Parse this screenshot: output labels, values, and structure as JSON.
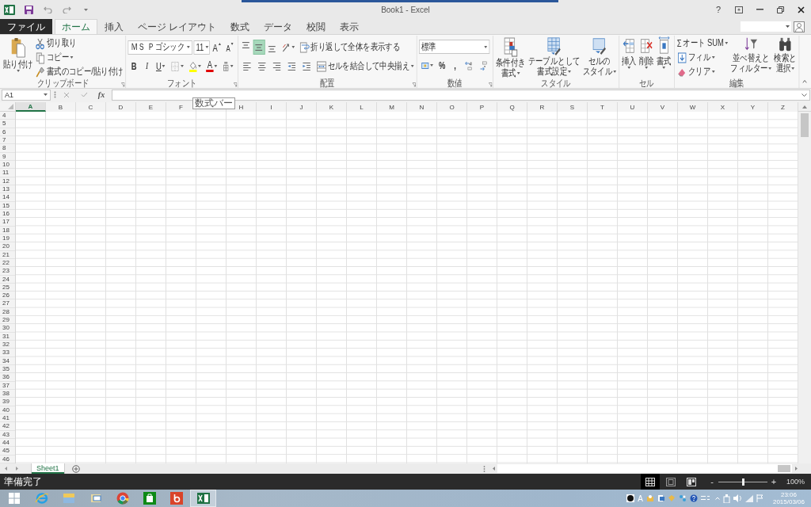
{
  "window": {
    "title": "Book1 - Excel",
    "help": "?"
  },
  "tabs": [
    {
      "label": "ファイル",
      "kind": "file",
      "selected": false
    },
    {
      "label": "ホーム",
      "kind": "tab",
      "selected": true
    },
    {
      "label": "挿入",
      "kind": "tab",
      "selected": false
    },
    {
      "label": "ページ レイアウト",
      "kind": "tab",
      "selected": false
    },
    {
      "label": "数式",
      "kind": "tab",
      "selected": false
    },
    {
      "label": "データ",
      "kind": "tab",
      "selected": false
    },
    {
      "label": "校閲",
      "kind": "tab",
      "selected": false
    },
    {
      "label": "表示",
      "kind": "tab",
      "selected": false
    }
  ],
  "ribbon": {
    "groups": [
      {
        "label": "クリップボード",
        "launcher": true,
        "sets": [
          [
            {
              "kind": "large",
              "lines": [
                "貼り付け"
              ],
              "menu": true
            }
          ],
          [
            {
              "kind": "small",
              "label": "切り取り"
            },
            {
              "kind": "small",
              "label": "コピー",
              "menu": true
            },
            {
              "kind": "small",
              "label": "書式のコピー/貼り付け"
            }
          ]
        ]
      },
      {
        "label": "フォント",
        "launcher": true,
        "sets": [
          [
            {
              "kind": "font_field",
              "value": "ＭＳ Ｐゴシック"
            },
            {
              "kind": "size_field",
              "value": "11"
            },
            {
              "kind": "grow",
              "glyph": "A"
            },
            {
              "kind": "shrink",
              "glyph": "A"
            }
          ],
          [
            {
              "kind": "bold",
              "glyph": "B"
            },
            {
              "kind": "italic",
              "glyph": "I"
            },
            {
              "kind": "underline",
              "glyph": "U",
              "menu": true
            },
            {
              "kind": "icon",
              "menu": true
            },
            {
              "kind": "fill",
              "color": "#ffff00",
              "menu": true
            },
            {
              "kind": "font_color",
              "glyph": "A",
              "color": "#e00000",
              "menu": true
            },
            {
              "kind": "icon",
              "menu": true
            }
          ]
        ]
      },
      {
        "label": "配置",
        "launcher": true,
        "sets": [
          [
            {
              "kind": "icon",
              "selected": false
            },
            {
              "kind": "icon",
              "selected": true
            },
            {
              "kind": "icon",
              "selected": false
            },
            {
              "kind": "icon",
              "menu": true
            },
            {
              "kind": "small",
              "label": "折り返して全体を表示する"
            }
          ],
          [
            {
              "kind": "icon",
              "selected": false
            },
            {
              "kind": "icon",
              "selected": false
            },
            {
              "kind": "icon",
              "selected": false
            },
            {
              "kind": "icon"
            },
            {
              "kind": "icon"
            },
            {
              "kind": "small",
              "label": "セルを結合して中央揃え",
              "menu": true
            }
          ]
        ]
      },
      {
        "label": "数値",
        "launcher": true,
        "sets": [
          [
            {
              "kind": "number_field",
              "value": "標準"
            }
          ],
          [
            {
              "kind": "icon",
              "menu": true
            },
            {
              "kind": "glyph",
              "glyph": "%"
            },
            {
              "kind": "glyph",
              "glyph": ","
            },
            {
              "kind": "icon"
            },
            {
              "kind": "icon"
            }
          ]
        ]
      },
      {
        "label": "スタイル",
        "sets": [
          [
            {
              "kind": "large",
              "lines": [
                "条件付き",
                "書式"
              ],
              "menu": true
            }
          ],
          [
            {
              "kind": "large",
              "lines": [
                "テーブルとして",
                "書式設定"
              ],
              "menu": true
            }
          ],
          [
            {
              "kind": "large",
              "lines": [
                "セルの",
                "スタイル"
              ],
              "menu": true
            }
          ]
        ]
      },
      {
        "label": "セル",
        "sets": [
          [
            {
              "kind": "large",
              "lines": [
                "挿入"
              ],
              "menu": true
            }
          ],
          [
            {
              "kind": "large",
              "lines": [
                "削除"
              ],
              "menu": true
            }
          ],
          [
            {
              "kind": "large",
              "lines": [
                "書式"
              ],
              "menu": true
            }
          ]
        ]
      },
      {
        "label": "編集",
        "sets": [
          [
            {
              "kind": "small",
              "glyph": "Σ",
              "label": "オート SUM",
              "menu": true
            },
            {
              "kind": "small",
              "label": "フィル",
              "menu": true
            },
            {
              "kind": "small",
              "label": "クリア",
              "menu": true
            }
          ],
          [
            {
              "kind": "large",
              "lines": [
                "並べ替えと",
                "フィルター"
              ],
              "menu": true
            }
          ],
          [
            {
              "kind": "large",
              "lines": [
                "検索と",
                "選択"
              ],
              "menu": true
            }
          ]
        ]
      }
    ]
  },
  "formula_bar": {
    "name_box": "A1",
    "function_glyph": "fx"
  },
  "tooltip": "数式バー",
  "sheet": {
    "columns": [
      {
        "label": "A",
        "selected": true
      },
      {
        "label": "B",
        "selected": false
      },
      {
        "label": "C",
        "selected": false
      },
      {
        "label": "D",
        "selected": false
      },
      {
        "label": "E",
        "selected": false
      },
      {
        "label": "F",
        "selected": false
      },
      {
        "selected": false
      },
      {
        "label": "H",
        "selected": false
      },
      {
        "label": "I",
        "selected": false
      },
      {
        "label": "J",
        "selected": false
      },
      {
        "label": "K",
        "selected": false
      },
      {
        "label": "L",
        "selected": false
      },
      {
        "label": "M",
        "selected": false
      },
      {
        "label": "N",
        "selected": false
      },
      {
        "label": "O",
        "selected": false
      },
      {
        "label": "P",
        "selected": false
      },
      {
        "label": "Q",
        "selected": false
      },
      {
        "label": "R",
        "selected": false
      },
      {
        "label": "S",
        "selected": false
      },
      {
        "label": "T",
        "selected": false
      },
      {
        "label": "U",
        "selected": false
      },
      {
        "label": "V",
        "selected": false
      },
      {
        "label": "W",
        "selected": false
      },
      {
        "label": "X",
        "selected": false
      },
      {
        "label": "Y",
        "selected": false
      },
      {
        "label": "Z",
        "selected": false
      }
    ],
    "rows": [
      "4",
      "5",
      "6",
      "7",
      "8",
      "9",
      "10",
      "11",
      "12",
      "13",
      "14",
      "15",
      "16",
      "17",
      "18",
      "19",
      "20",
      "21",
      "22",
      "23",
      "24",
      "25",
      "26",
      "27",
      "28",
      "29",
      "30",
      "31",
      "32",
      "33",
      "34",
      "35",
      "36",
      "37",
      "38",
      "39",
      "40",
      "41",
      "42",
      "43",
      "44",
      "45",
      "46"
    ]
  },
  "sheet_tabs": [
    {
      "label": "Sheet1",
      "selected": true
    }
  ],
  "status_bar": {
    "text": "準備完了",
    "views": [
      {
        "selected": true
      },
      {
        "selected": false
      },
      {
        "selected": false
      }
    ],
    "zoom": {
      "minus": "-",
      "plus": "+",
      "level": 0.5,
      "reading": "100%"
    }
  },
  "taskbar": {
    "apps": [
      {
        "selected": false
      },
      {
        "selected": false
      },
      {
        "selected": false
      },
      {
        "selected": false
      },
      {
        "selected": false
      },
      {
        "selected": false
      },
      {
        "selected": true
      }
    ],
    "ime": "A",
    "time": "23:06",
    "date": "2015/03/06"
  }
}
